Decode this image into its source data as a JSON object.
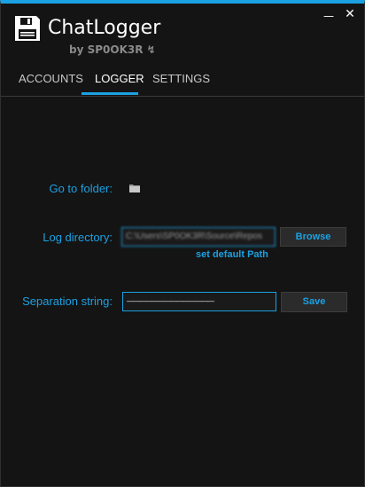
{
  "app": {
    "title": "ChatLogger",
    "subtitle": "by SP0OK3R ↯"
  },
  "window_controls": {
    "minimize": "—",
    "close": "✕"
  },
  "tabs": [
    {
      "label": "ACCOUNTS",
      "active": false
    },
    {
      "label": "LOGGER",
      "active": true
    },
    {
      "label": "SETTINGS",
      "active": false
    }
  ],
  "logger": {
    "go_to_folder_label": "Go to folder:",
    "log_directory_label": "Log directory:",
    "log_directory_value": "C:\\Users\\SP0OK3R\\Source\\Repos",
    "browse_label": "Browse",
    "set_default_label": "set default Path",
    "separation_label": "Separation string:",
    "separation_value": "——————————————",
    "save_label": "Save"
  },
  "colors": {
    "accent": "#1ba1e2",
    "background": "#141414",
    "text": "#ffffff"
  },
  "icons": [
    "floppy-disk-icon",
    "folder-icon"
  ]
}
